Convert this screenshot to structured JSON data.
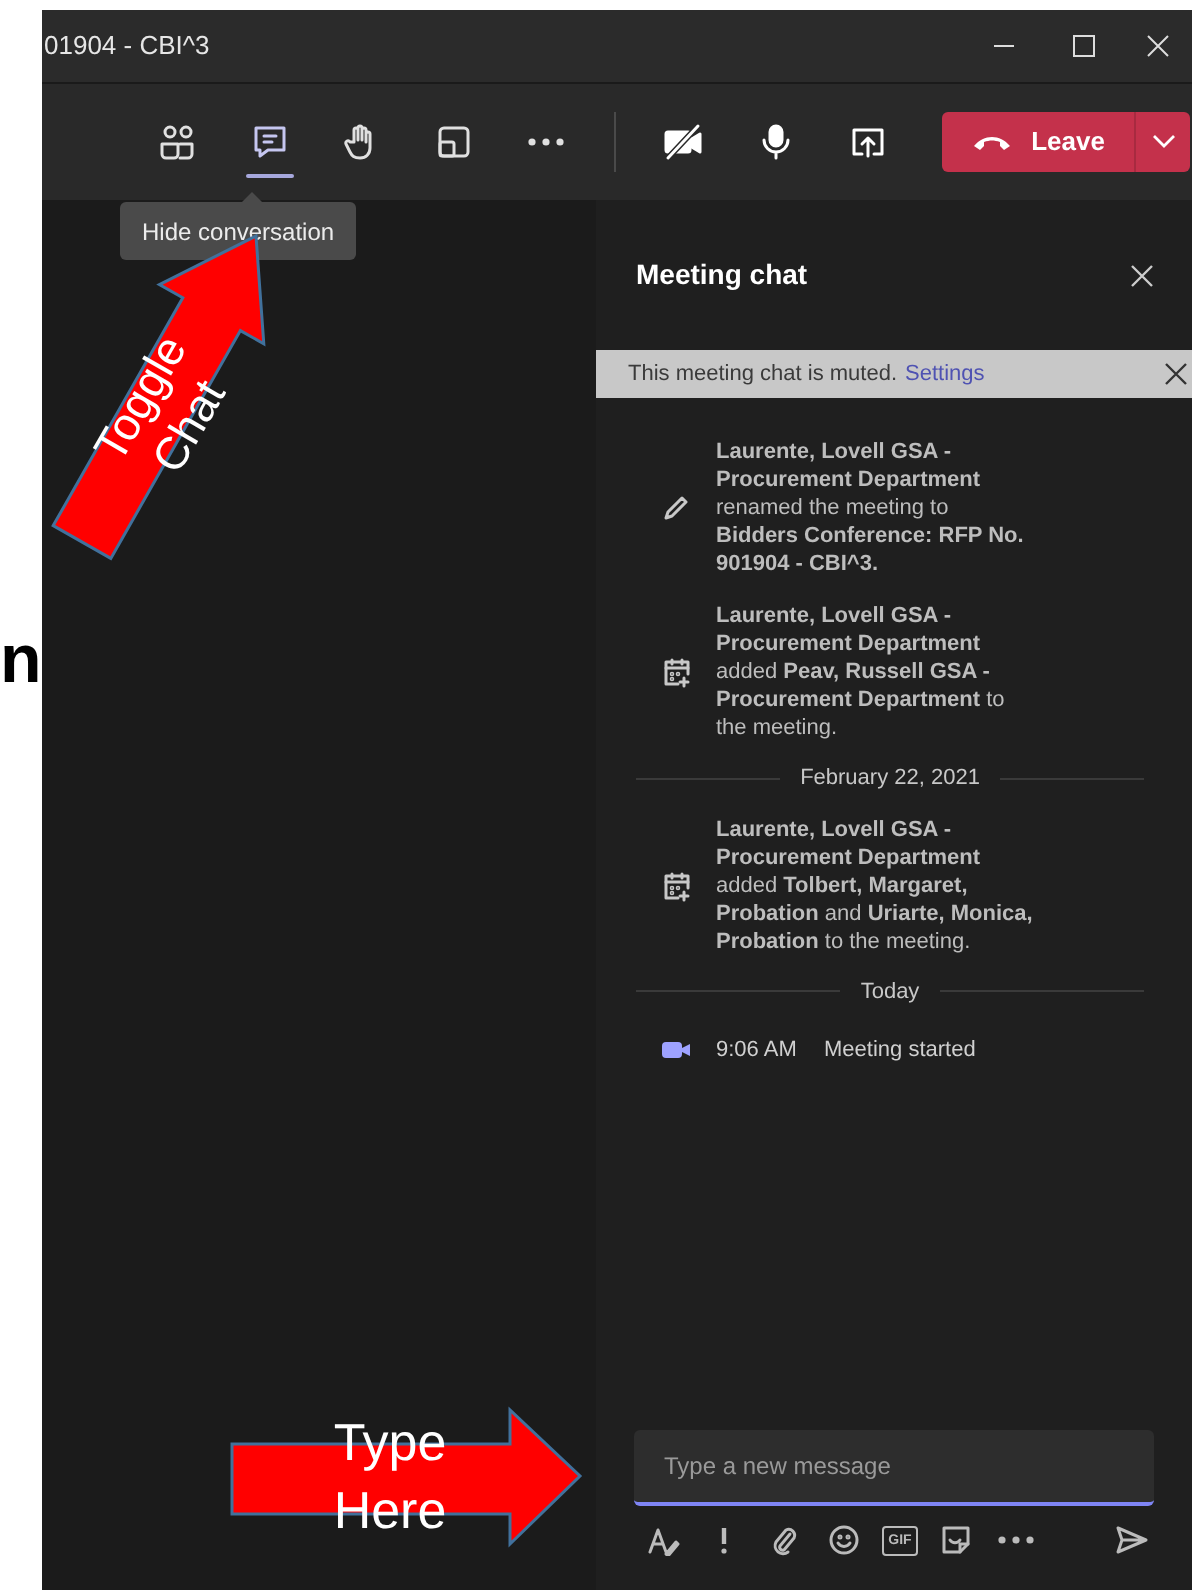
{
  "outside_fragment": "n",
  "window": {
    "title": "01904 - CBI^3"
  },
  "toolbar": {
    "buttons": [
      {
        "kind": "people",
        "selected": false
      },
      {
        "kind": "chat",
        "selected": true
      },
      {
        "kind": "hand",
        "selected": false
      },
      {
        "kind": "layout",
        "selected": false
      },
      {
        "kind": "more",
        "selected": false
      }
    ],
    "media": [
      {
        "kind": "camera-off"
      },
      {
        "kind": "mic"
      },
      {
        "kind": "share"
      }
    ],
    "leave": "Leave"
  },
  "tooltip": "Hide conversation",
  "annotations": [
    {
      "kind": "diagonal",
      "text": "Toggle Chat"
    },
    {
      "kind": "right",
      "text": "Type Here"
    }
  ],
  "chat": {
    "title": "Meeting chat",
    "banner": {
      "text": "This meeting chat is muted.",
      "link": "Settings"
    },
    "items": [
      {
        "kind": "renamed",
        "text": "**Laurente, Lovell GSA - Procurement Department** renamed the meeting to **Bidders Conference: RFP No. 901904 - CBI^3.**"
      },
      {
        "kind": "added",
        "text": "**Laurente, Lovell GSA - Procurement Department** added **Peav, Russell GSA - Procurement Department** to the meeting."
      },
      {
        "kind": "date",
        "text": "February 22, 2021"
      },
      {
        "kind": "added",
        "text": "**Laurente, Lovell GSA - Procurement Department** added **Tolbert, Margaret, Probation** and **Uriarte, Monica, Probation** to the meeting."
      },
      {
        "kind": "date",
        "text": "Today"
      },
      {
        "kind": "meeting",
        "time": "9:06 AM",
        "text": "Meeting started"
      }
    ],
    "compose": {
      "placeholder": "Type a new message",
      "gif": "GIF"
    }
  }
}
